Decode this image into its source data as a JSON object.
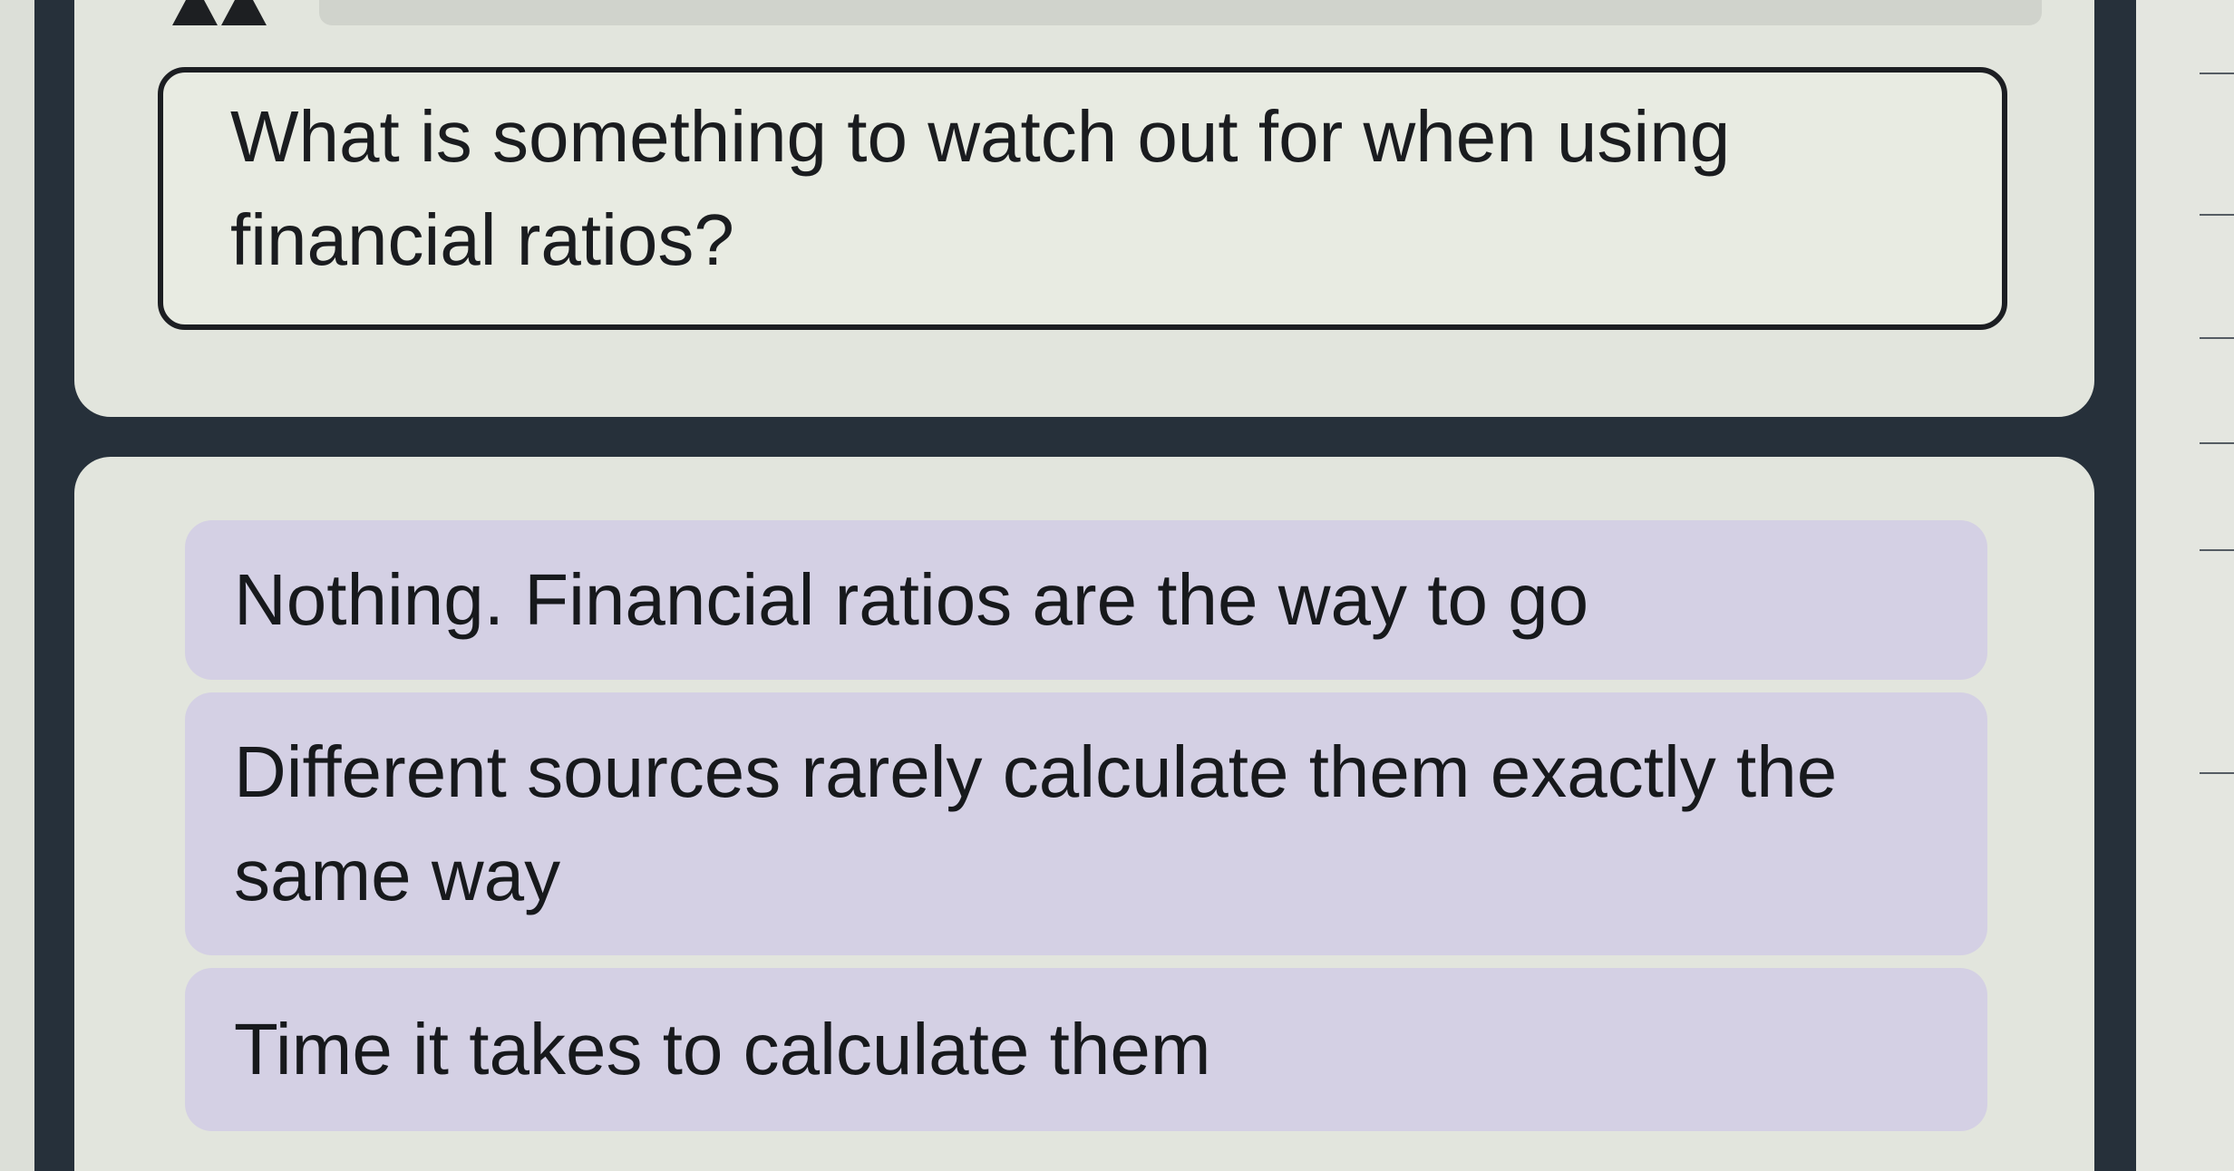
{
  "question": {
    "text": "What is something to watch out for when using financial ratios?"
  },
  "options": [
    {
      "label": "Nothing. Financial ratios are the way to go"
    },
    {
      "label": "Different sources rarely calculate them exactly the same way"
    },
    {
      "label": "Time it takes to calculate them"
    }
  ],
  "colors": {
    "frame": "#26303a",
    "card": "#e2e5dd",
    "option_background": "#d4d0e4",
    "text": "#17191c"
  }
}
